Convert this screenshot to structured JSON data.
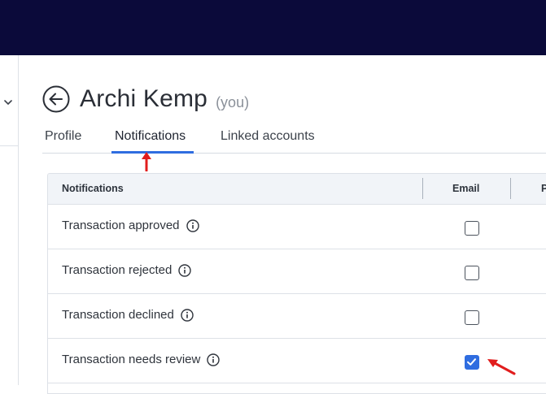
{
  "header": {
    "background": "#0b0a3a"
  },
  "left_panel": {
    "icon": "chevron-down-icon"
  },
  "page": {
    "back_icon": "back-arrow-circle-icon",
    "title": "Archi Kemp",
    "you_label": "(you)"
  },
  "tabs": [
    {
      "label": "Profile",
      "active": false
    },
    {
      "label": "Notifications",
      "active": true
    },
    {
      "label": "Linked accounts",
      "active": false
    }
  ],
  "accent_color": "#2f6de0",
  "annotation_color": "#e11d1d",
  "table": {
    "columns": [
      "Notifications",
      "Email",
      "P"
    ],
    "rows": [
      {
        "label": "Transaction approved",
        "email_checked": false,
        "info_icon": "info-icon"
      },
      {
        "label": "Transaction rejected",
        "email_checked": false,
        "info_icon": "info-icon"
      },
      {
        "label": "Transaction declined",
        "email_checked": false,
        "info_icon": "info-icon"
      },
      {
        "label": "Transaction needs review",
        "email_checked": true,
        "info_icon": "info-icon"
      }
    ]
  }
}
